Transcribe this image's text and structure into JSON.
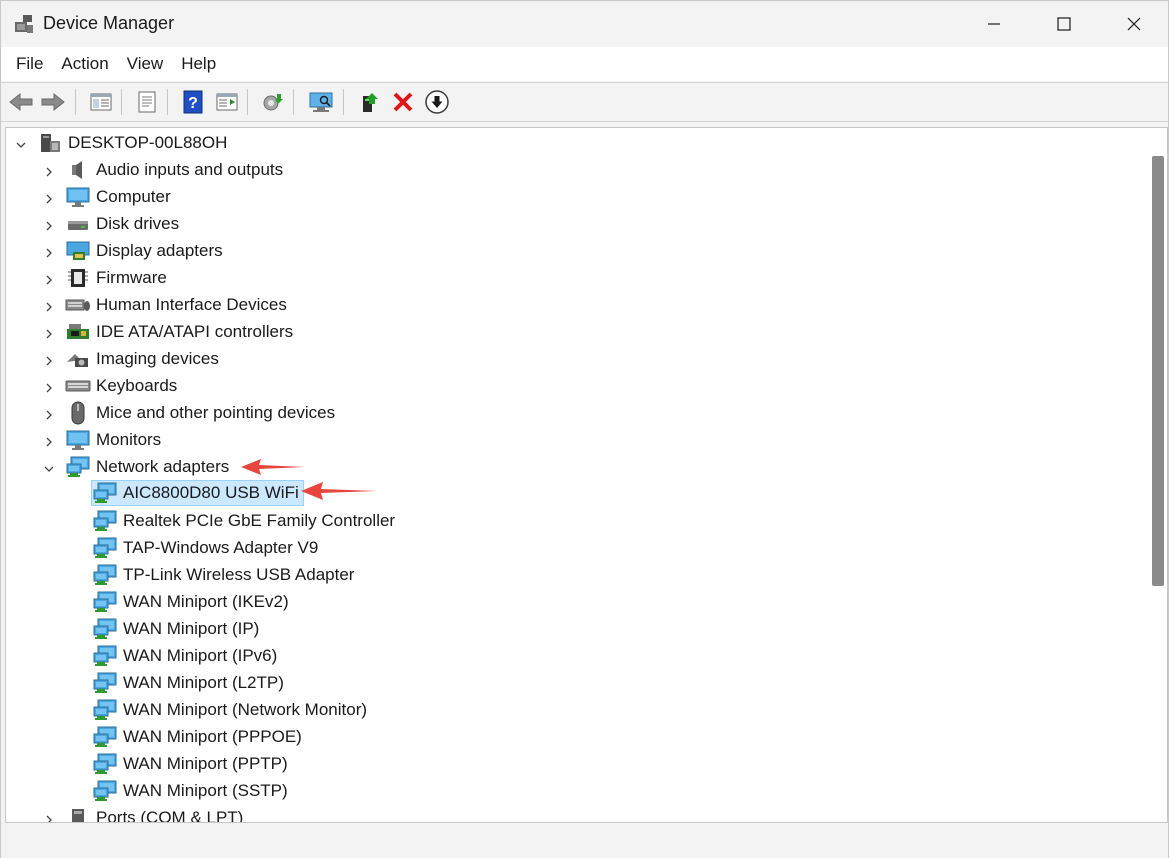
{
  "window": {
    "title": "Device Manager",
    "minimize_label": "Minimize",
    "maximize_label": "Maximize",
    "close_label": "Close"
  },
  "menu": {
    "items": [
      "File",
      "Action",
      "View",
      "Help"
    ]
  },
  "toolbar": {
    "buttons": [
      "back-icon",
      "forward-icon",
      "show-hide-console-tree-icon",
      "properties-icon",
      "help-icon",
      "action-pane-icon",
      "update-driver-icon",
      "scan-hardware-icon",
      "enable-device-icon",
      "uninstall-device-icon",
      "disable-device-icon"
    ]
  },
  "tree": {
    "root": "DESKTOP-00L88OH",
    "categories": [
      {
        "label": "Audio inputs and outputs",
        "icon": "speaker-icon"
      },
      {
        "label": "Computer",
        "icon": "monitor-icon"
      },
      {
        "label": "Disk drives",
        "icon": "disk-drive-icon"
      },
      {
        "label": "Display adapters",
        "icon": "display-adapter-icon"
      },
      {
        "label": "Firmware",
        "icon": "chip-icon"
      },
      {
        "label": "Human Interface Devices",
        "icon": "hid-icon"
      },
      {
        "label": "IDE ATA/ATAPI controllers",
        "icon": "ide-controller-icon"
      },
      {
        "label": "Imaging devices",
        "icon": "camera-icon"
      },
      {
        "label": "Keyboards",
        "icon": "keyboard-icon"
      },
      {
        "label": "Mice and other pointing devices",
        "icon": "mouse-icon"
      },
      {
        "label": "Monitors",
        "icon": "monitor-icon"
      },
      {
        "label": "Network adapters",
        "icon": "network-adapter-icon",
        "expanded": true
      }
    ],
    "network_adapters": [
      "AIC8800D80 USB WiFi",
      "Realtek PCIe GbE Family Controller",
      "TAP-Windows Adapter V9",
      "TP-Link Wireless USB Adapter",
      "WAN Miniport (IKEv2)",
      "WAN Miniport (IP)",
      "WAN Miniport (IPv6)",
      "WAN Miniport (L2TP)",
      "WAN Miniport (Network Monitor)",
      "WAN Miniport (PPPOE)",
      "WAN Miniport (PPTP)",
      "WAN Miniport (SSTP)"
    ],
    "selected_adapter": "AIC8800D80 USB WiFi",
    "partial_category": "Ports (COM & LPT)"
  },
  "colors": {
    "selection_bg": "#cce8ff",
    "selection_border": "#99d1ff",
    "annotation_arrow": "#e8453c"
  }
}
